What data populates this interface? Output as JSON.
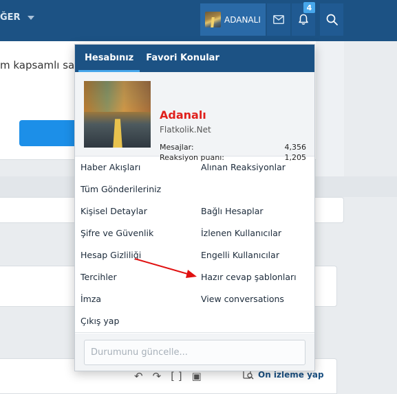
{
  "topbar": {
    "nav_more_label": "ĞER",
    "username": "ADANALI",
    "alerts_count": "4"
  },
  "background": {
    "partial_text": "m kapsamlı sa",
    "preview_label": "Ön izleme yap"
  },
  "account_menu": {
    "tabs": [
      {
        "label": "Hesabınız",
        "active": true
      },
      {
        "label": "Favori Konular",
        "active": false
      }
    ],
    "profile": {
      "name": "Adanalı",
      "site": "Flatkolik.Net",
      "stats": [
        {
          "label": "Mesajlar:",
          "value": "4,356"
        },
        {
          "label": "Reaksiyon puanı:",
          "value": "1,205"
        }
      ]
    },
    "links_left": [
      "Haber Akışları",
      "Tüm Gönderileriniz",
      "Kişisel Detaylar",
      "Şifre ve Güvenlik",
      "Hesap Gizliliği",
      "Tercihler",
      "İmza",
      "Çıkış yap"
    ],
    "links_right": [
      "Alınan Reaksiyonlar",
      "Bağlı Hesaplar",
      "İzlenen Kullanıcılar",
      "Engelli Kullanıcılar",
      "Hazır cevap şablonları",
      "View conversations"
    ],
    "status_placeholder": "Durumunu güncelle..."
  },
  "colors": {
    "header": "#1c5284",
    "accent": "#47a7eb",
    "username_red": "#e0201c",
    "annotation_arrow": "#e01010"
  }
}
